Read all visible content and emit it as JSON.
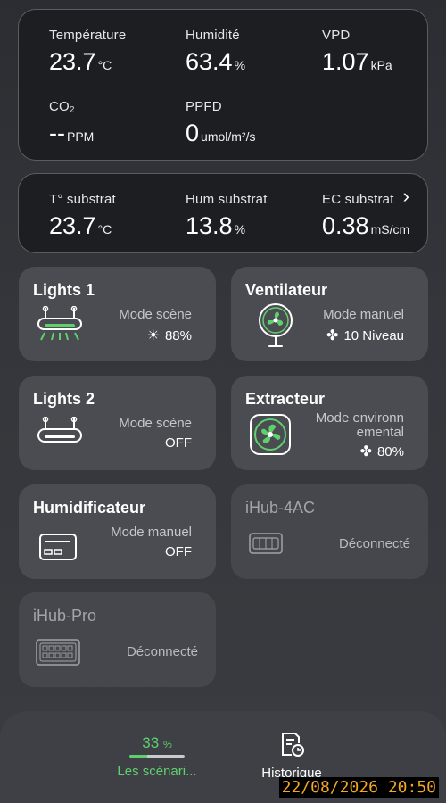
{
  "environment": {
    "temperature": {
      "label": "Température",
      "value": "23.7",
      "unit": "°C"
    },
    "humidity": {
      "label": "Humidité",
      "value": "63.4",
      "unit": "%"
    },
    "vpd": {
      "label": "VPD",
      "value": "1.07",
      "unit": "kPa"
    },
    "co2": {
      "label": "CO₂",
      "value": "--",
      "unit": "PPM"
    },
    "ppfd": {
      "label": "PPFD",
      "value": "0",
      "unit": "umol/m²/s"
    }
  },
  "substrate": {
    "temperature": {
      "label": "T° substrat",
      "value": "23.7",
      "unit": "°C"
    },
    "humidity": {
      "label": "Hum substrat",
      "value": "13.8",
      "unit": "%"
    },
    "ec": {
      "label": "EC substrat",
      "value": "0.38",
      "unit": "mS/cm"
    },
    "chevron": "›"
  },
  "devices": {
    "lights1": {
      "title": "Lights 1",
      "mode": "Mode scène",
      "status": "88%",
      "status_icon": "sun-icon",
      "active": true
    },
    "ventilateur": {
      "title": "Ventilateur",
      "mode": "Mode manuel",
      "status": "10 Niveau",
      "status_icon": "fan-icon"
    },
    "lights2": {
      "title": "Lights 2",
      "mode": "Mode scène",
      "status": "OFF"
    },
    "extracteur": {
      "title": "Extracteur",
      "mode_line1": "Mode environn",
      "mode_line2": "emental",
      "status": "80%",
      "status_icon": "fan-icon"
    },
    "humidificateur": {
      "title": "Humidificateur",
      "mode": "Mode manuel",
      "status": "OFF"
    },
    "ihub4ac": {
      "title": "iHub-4AC",
      "status": "Déconnecté"
    },
    "ihubpro": {
      "title": "iHub-Pro",
      "status": "Déconnecté"
    }
  },
  "bottom_nav": {
    "scenes": {
      "percent": "33",
      "percent_unit": "%",
      "label": "Les scénari...",
      "progress": 0.33
    },
    "history": {
      "label": "Historique"
    }
  },
  "timestamp": "22/08/2026 20:50",
  "colors": {
    "accent_green": "#5fd06e",
    "panel_bg": "#1d1e22",
    "card_bg": "#4a4c51",
    "timestamp_fg": "#f5a623"
  }
}
